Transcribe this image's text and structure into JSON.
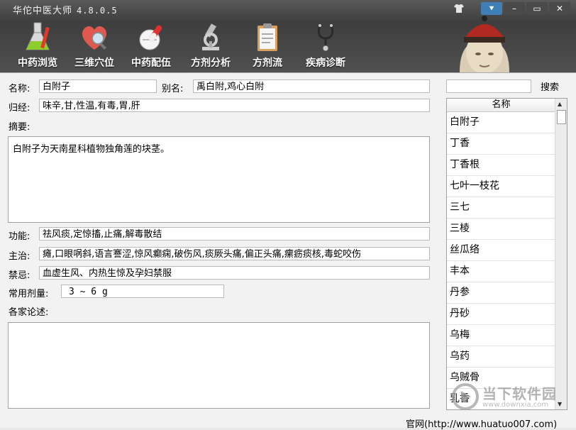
{
  "window": {
    "app_name": "华佗中医大师",
    "version": "4.8.0.5",
    "controls": [
      "⯆",
      "–",
      "▭",
      "✕"
    ]
  },
  "toolbar": {
    "items": [
      {
        "label": "中药浏览",
        "icon": "flask-icon"
      },
      {
        "label": "三维穴位",
        "icon": "heart-magnifier-icon"
      },
      {
        "label": "中药配伍",
        "icon": "pills-icon"
      },
      {
        "label": "方剂分析",
        "icon": "microscope-icon"
      },
      {
        "label": "方剂流",
        "icon": "clipboard-icon"
      },
      {
        "label": "疾病诊断",
        "icon": "stethoscope-icon"
      }
    ]
  },
  "form": {
    "name_label": "名称:",
    "name_value": "白附子",
    "alias_label": "别名:",
    "alias_value": "禹白附,鸡心白附",
    "meridian_label": "归经:",
    "meridian_value": "味辛,甘,性温,有毒,胃,肝",
    "summary_label": "摘要:",
    "summary_value": "白附子为天南星科植物独角莲的块茎。",
    "function_label": "功能:",
    "function_value": "祛风痰,定惊搐,止痛,解毒散结",
    "indication_label": "主治:",
    "indication_value": "瘫,口眼㖞斜,语言謇涩,惊风癫痫,破伤风,痰厥头痛,偏正头痛,瘰疬痰核,毒蛇咬伤",
    "contraindication_label": "禁忌:",
    "contraindication_value": "血虚生风、内热生惊及孕妇禁服",
    "dosage_label": "常用剂量:",
    "dosage_value": "3 ~ 6 g",
    "commentary_label": "各家论述:",
    "commentary_value": ""
  },
  "search": {
    "value": "",
    "button_label": "搜索"
  },
  "list": {
    "header": "名称",
    "items": [
      "白附子",
      "丁香",
      "丁香根",
      "七叶一枝花",
      "三七",
      "三棱",
      "丝瓜络",
      "丰本",
      "丹参",
      "丹砂",
      "乌梅",
      "乌药",
      "乌贼骨",
      "乳香"
    ]
  },
  "footer": {
    "site_text": "官网(http://www.huatuo007.com)"
  },
  "watermark": {
    "title": "当下软件园",
    "url": "www.downxia.com"
  },
  "colors": {
    "header_bg": "#4a4a4a",
    "accent": "#3f7fb5"
  }
}
